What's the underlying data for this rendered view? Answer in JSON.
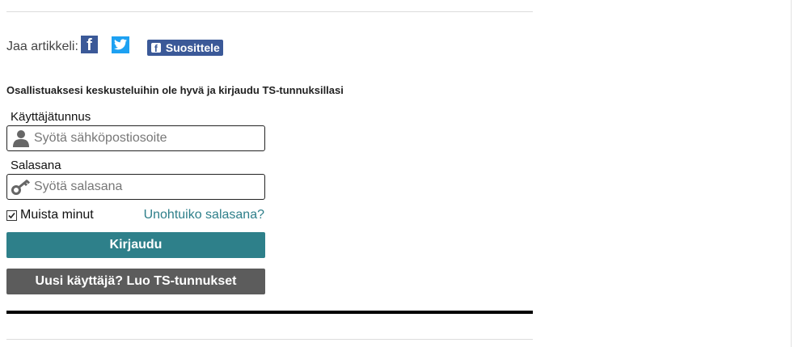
{
  "share": {
    "label": "Jaa artikkeli:",
    "facebook_glyph": "f",
    "recommend_label": "Suosittele",
    "recommend_badge": "f",
    "icons": [
      "facebook-icon",
      "twitter-icon"
    ],
    "colors": {
      "facebook": "#3b5998",
      "twitter": "#1da1f2"
    }
  },
  "login": {
    "prompt": "Osallistuaksesi keskusteluihin ole hyvä ja kirjaudu TS-tunnuksillasi",
    "username": {
      "label": "Käyttäjätunnus",
      "placeholder": "Syötä sähköpostiosoite",
      "value": "",
      "icon": "user-icon"
    },
    "password": {
      "label": "Salasana",
      "placeholder": "Syötä salasana",
      "value": "",
      "icon": "key-icon"
    },
    "remember": {
      "label": "Muista minut",
      "checked": true
    },
    "forgot_label": "Unohtuiko salasana?",
    "submit_label": "Kirjaudu",
    "register_label": "Uusi käyttäjä? Luo TS-tunnukset",
    "colors": {
      "primary": "#2e808a",
      "secondary": "#5c5c5c",
      "link": "#2e7f8a"
    }
  }
}
